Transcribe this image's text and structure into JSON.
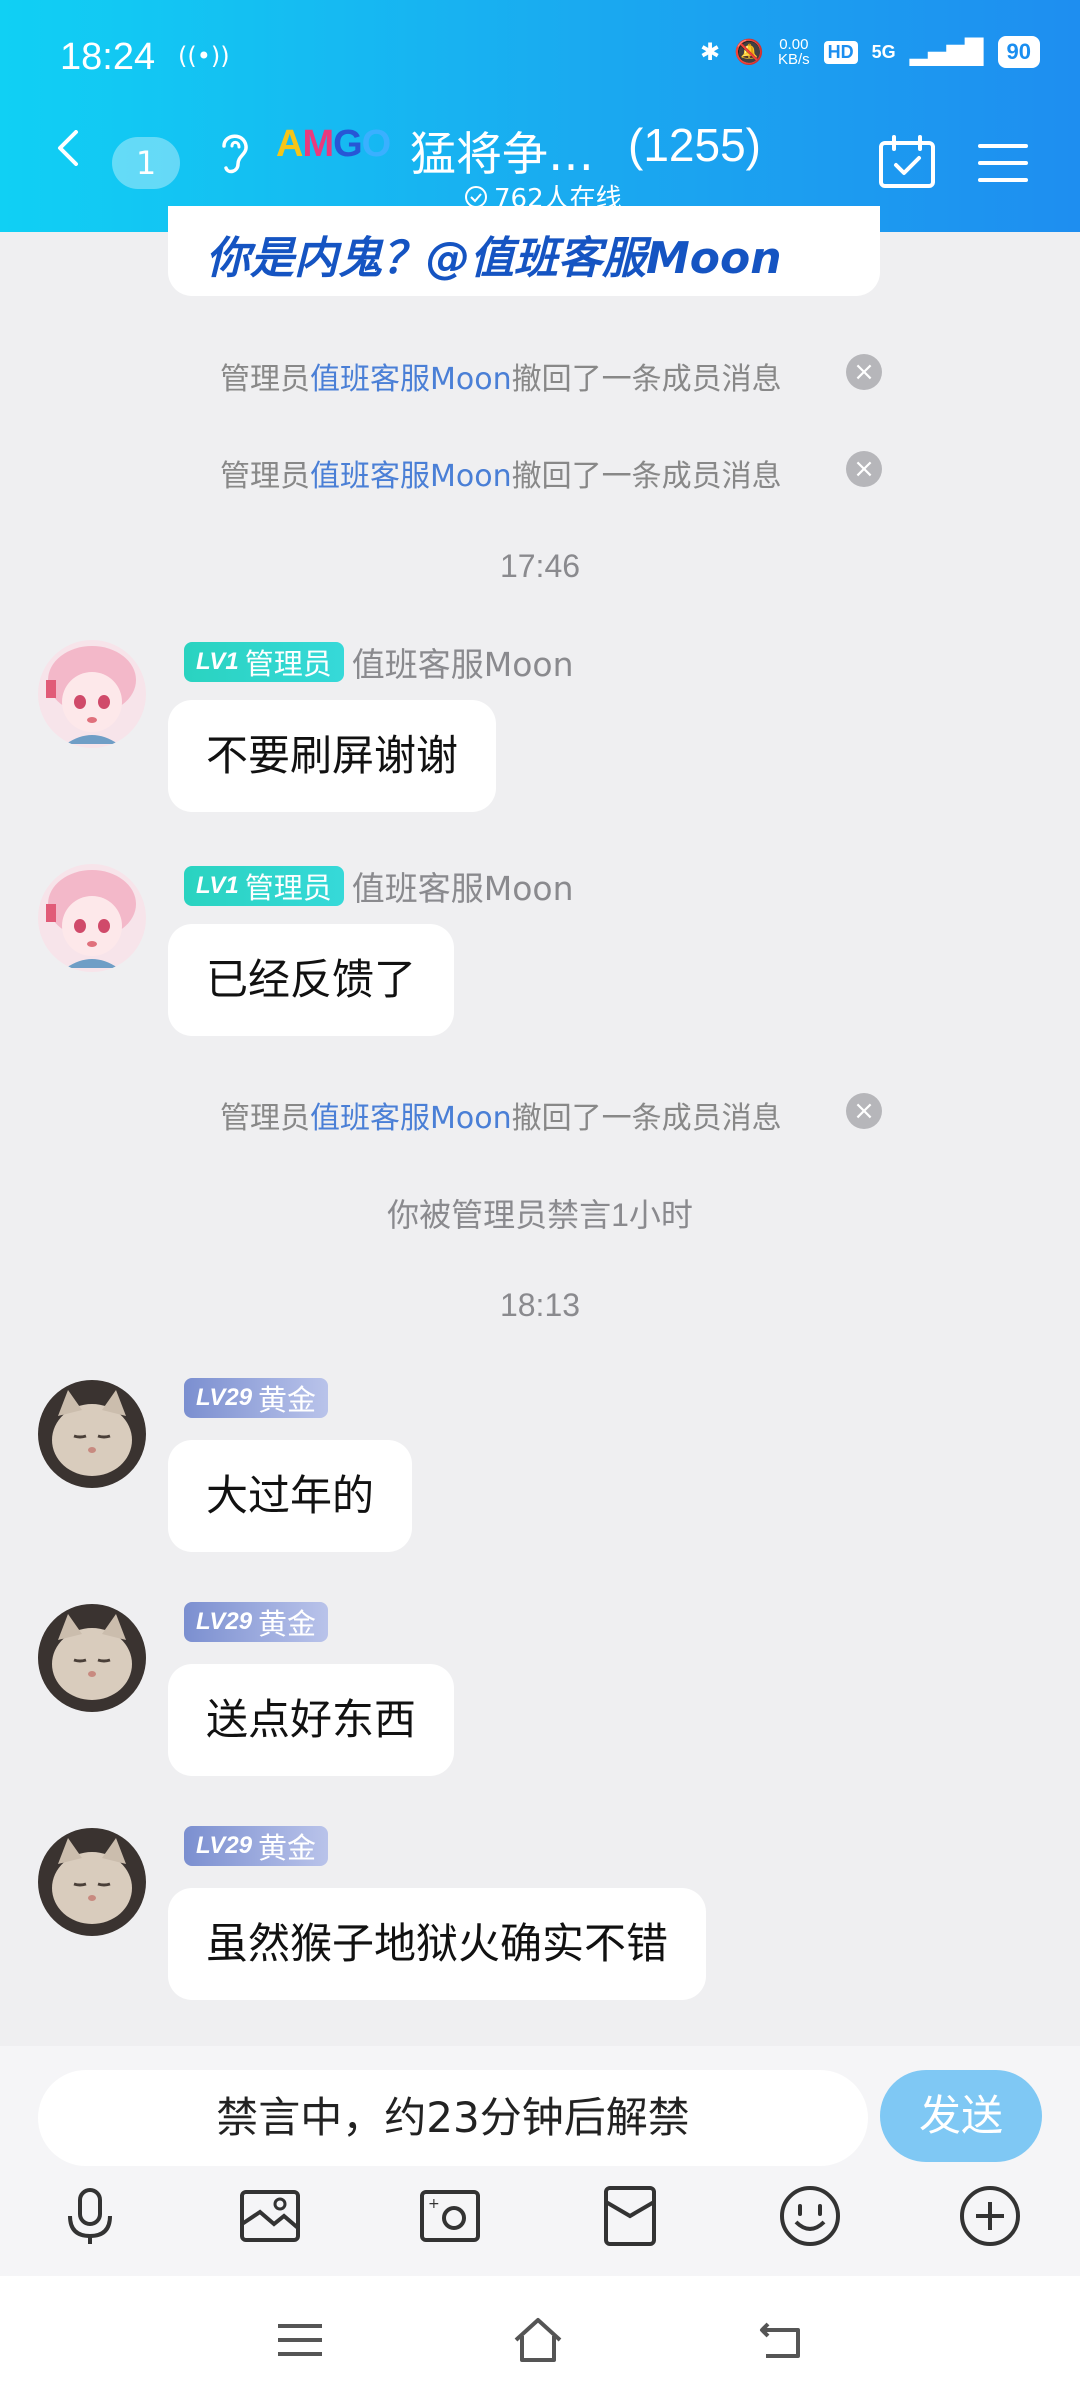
{
  "status_bar": {
    "time": "18:24",
    "speed_value": "0.00",
    "speed_unit": "KB/s",
    "hd": "HD",
    "network": "5G",
    "battery": "90"
  },
  "header": {
    "unread_count": "1",
    "logo_text": [
      "A",
      "M",
      "G",
      "O"
    ],
    "title": "猛将争…",
    "member_count": "(1255)",
    "online": "762人在线"
  },
  "top_message": "你是内鬼？@值班客服Moon",
  "recall_notice": {
    "prefix": "管理员",
    "admin": "值班客服Moon",
    "suffix": "撤回了一条成员消息"
  },
  "timestamps": [
    "17:46",
    "18:13"
  ],
  "admin_sender": {
    "level": "LV1",
    "role": "管理员",
    "name": "值班客服Moon"
  },
  "gold_sender": {
    "level": "LV29",
    "role": "黄金"
  },
  "messages_admin": [
    "不要刷屏谢谢",
    "已经反馈了"
  ],
  "mute_notice": "你被管理员禁言1小时",
  "messages_gold": [
    "大过年的",
    "送点好东西",
    "虽然猴子地狱火确实不错"
  ],
  "input": {
    "muted_text": "禁言中，约23分钟后解禁",
    "send_label": "发送"
  },
  "colors": {
    "header_start": "#10d0f4",
    "header_end": "#1e8ef0",
    "link": "#4a7fd6",
    "admin_badge": "#2ad3c0",
    "send_button": "#7fc8f4"
  },
  "icons": [
    "back-icon",
    "ear-icon",
    "calendar-check-icon",
    "menu-icon",
    "mic-icon",
    "image-icon",
    "camera-icon",
    "red-packet-icon",
    "emoji-icon",
    "plus-icon",
    "nav-menu-icon",
    "nav-home-icon",
    "nav-back-icon"
  ]
}
